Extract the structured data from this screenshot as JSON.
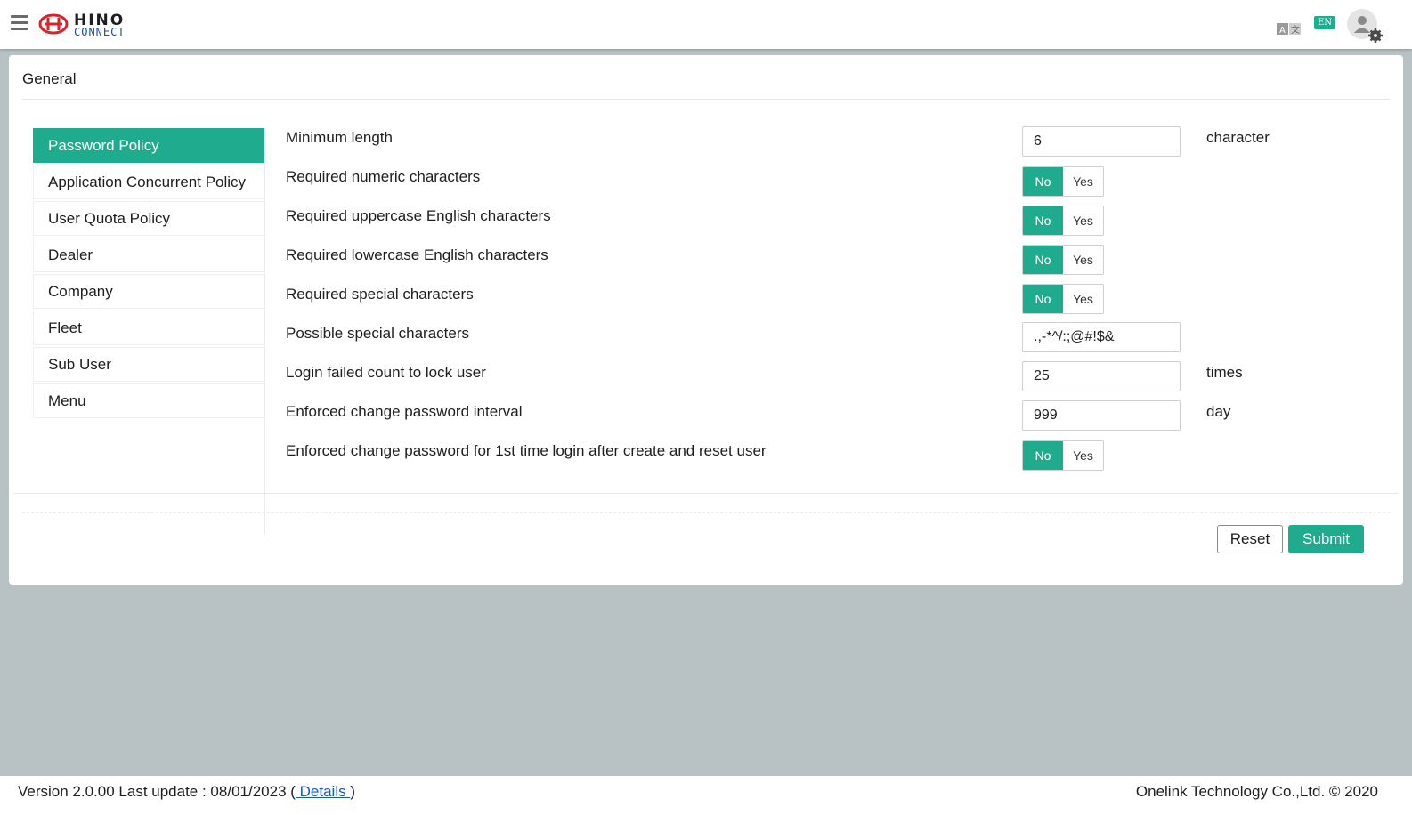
{
  "header": {
    "logo_text_top": "HINO",
    "logo_text_bottom": "CONNECT",
    "language_badge": "EN",
    "icons": {
      "menu": "hamburger-icon",
      "language": "translate-icon",
      "user": "user-settings-icon"
    }
  },
  "page": {
    "title": "General"
  },
  "sidebar": {
    "items": [
      {
        "label": "Password Policy",
        "active": true
      },
      {
        "label": "Application Concurrent Policy",
        "active": false
      },
      {
        "label": "User Quota Policy",
        "active": false
      },
      {
        "label": "Dealer",
        "active": false
      },
      {
        "label": "Company",
        "active": false
      },
      {
        "label": "Fleet",
        "active": false
      },
      {
        "label": "Sub User",
        "active": false
      },
      {
        "label": "Menu",
        "active": false
      }
    ]
  },
  "form": {
    "min_length": {
      "label": "Minimum length",
      "value": "6",
      "unit": "character"
    },
    "numeric": {
      "label": "Required numeric characters",
      "no": "No",
      "yes": "Yes",
      "selected": "No"
    },
    "uppercase": {
      "label": "Required uppercase English characters",
      "no": "No",
      "yes": "Yes",
      "selected": "No"
    },
    "lowercase": {
      "label": "Required lowercase English characters",
      "no": "No",
      "yes": "Yes",
      "selected": "No"
    },
    "special": {
      "label": "Required special characters",
      "no": "No",
      "yes": "Yes",
      "selected": "No"
    },
    "possible_special": {
      "label": "Possible special characters",
      "value": ".,-*^/:;@#!$&"
    },
    "lock_count": {
      "label": "Login failed count to lock user",
      "value": "25",
      "unit": "times"
    },
    "change_interval": {
      "label": "Enforced change password interval",
      "value": "999",
      "unit": "day"
    },
    "first_login": {
      "label": "Enforced change password for 1st time login after create and reset user",
      "no": "No",
      "yes": "Yes",
      "selected": "No"
    }
  },
  "actions": {
    "reset": "Reset",
    "submit": "Submit"
  },
  "footer": {
    "version_text": "Version 2.0.00 Last update : 08/01/2023 (",
    "details_link": " Details ",
    "close_paren": ")",
    "copyright": "Onelink Technology Co.,Ltd. © 2020"
  },
  "colors": {
    "accent": "#1fac8e",
    "background": "#b8c2c5",
    "link": "#1a56c7"
  }
}
